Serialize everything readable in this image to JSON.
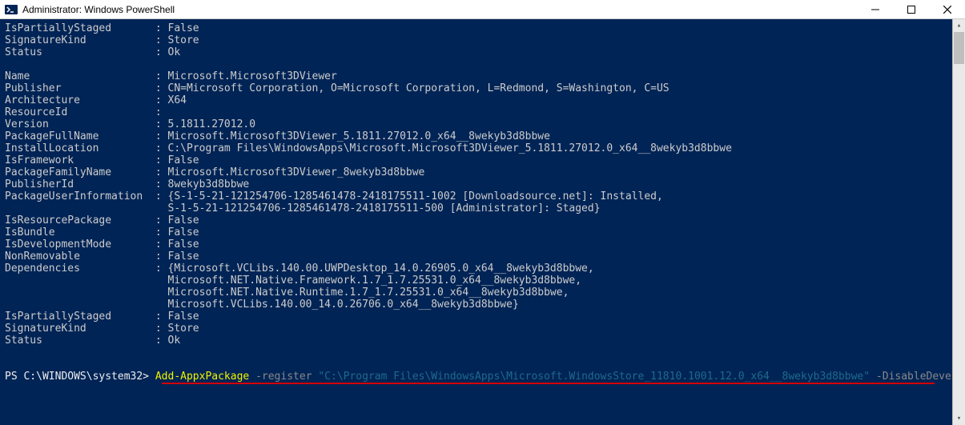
{
  "window": {
    "title": "Administrator: Windows PowerShell"
  },
  "prompt": {
    "prefix": "PS C:\\WINDOWS\\system32> ",
    "cmd": "Add-AppxPackage",
    "flag1": " -register ",
    "path": "\"C:\\Program Files\\WindowsApps\\Microsoft.WindowsStore_11810.1001.12.0_x64__8wekyb3d8bbwe\"",
    "flag2": " -DisableDevelopmentMode"
  },
  "fields_top": [
    [
      "IsPartiallyStaged",
      "False"
    ],
    [
      "SignatureKind",
      "Store"
    ],
    [
      "Status",
      "Ok"
    ]
  ],
  "fields_pkg": [
    [
      "Name",
      "Microsoft.Microsoft3DViewer"
    ],
    [
      "Publisher",
      "CN=Microsoft Corporation, O=Microsoft Corporation, L=Redmond, S=Washington, C=US"
    ],
    [
      "Architecture",
      "X64"
    ],
    [
      "ResourceId",
      ""
    ],
    [
      "Version",
      "5.1811.27012.0"
    ],
    [
      "PackageFullName",
      "Microsoft.Microsoft3DViewer_5.1811.27012.0_x64__8wekyb3d8bbwe"
    ],
    [
      "InstallLocation",
      "C:\\Program Files\\WindowsApps\\Microsoft.Microsoft3DViewer_5.1811.27012.0_x64__8wekyb3d8bbwe"
    ],
    [
      "IsFramework",
      "False"
    ],
    [
      "PackageFamilyName",
      "Microsoft.Microsoft3DViewer_8wekyb3d8bbwe"
    ],
    [
      "PublisherId",
      "8wekyb3d8bbwe"
    ]
  ],
  "user_info": {
    "key": "PackageUserInformation",
    "l1": "{S-1-5-21-121254706-1285461478-2418175511-1002 [Downloadsource.net]: Installed,",
    "l2": "S-1-5-21-121254706-1285461478-2418175511-500 [Administrator]: Staged}"
  },
  "fields_mid": [
    [
      "IsResourcePackage",
      "False"
    ],
    [
      "IsBundle",
      "False"
    ],
    [
      "IsDevelopmentMode",
      "False"
    ],
    [
      "NonRemovable",
      "False"
    ]
  ],
  "deps": {
    "key": "Dependencies",
    "l1": "{Microsoft.VCLibs.140.00.UWPDesktop_14.0.26905.0_x64__8wekyb3d8bbwe,",
    "l2": "Microsoft.NET.Native.Framework.1.7_1.7.25531.0_x64__8wekyb3d8bbwe,",
    "l3": "Microsoft.NET.Native.Runtime.1.7_1.7.25531.0_x64__8wekyb3d8bbwe,",
    "l4": "Microsoft.VCLibs.140.00_14.0.26706.0_x64__8wekyb3d8bbwe}"
  },
  "fields_bottom": [
    [
      "IsPartiallyStaged",
      "False"
    ],
    [
      "SignatureKind",
      "Store"
    ],
    [
      "Status",
      "Ok"
    ]
  ]
}
